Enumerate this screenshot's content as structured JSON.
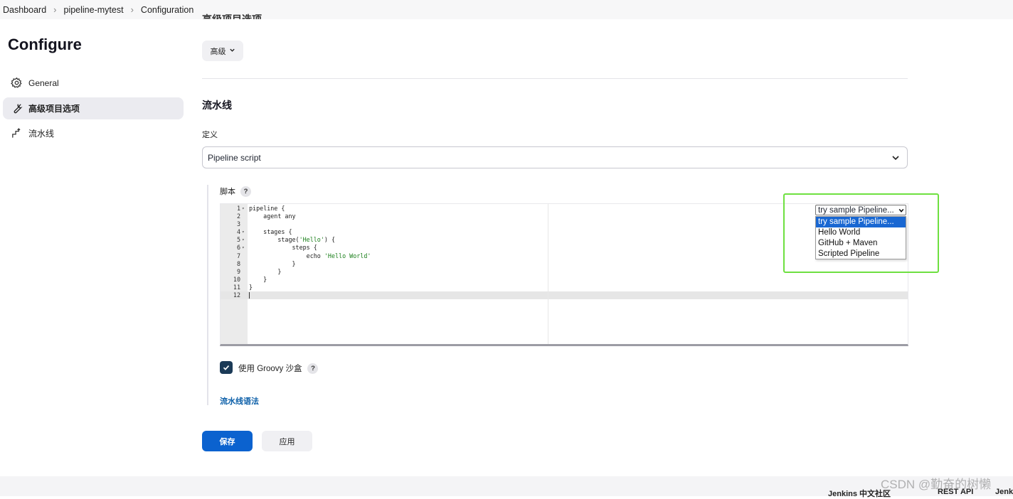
{
  "breadcrumb": [
    "Dashboard",
    "pipeline-mytest",
    "Configuration"
  ],
  "page_title": "Configure",
  "partial_section_header": "高级项目选项",
  "sidebar": {
    "items": [
      {
        "label": "General",
        "icon": "gear-icon",
        "active": false
      },
      {
        "label": "高级项目选项",
        "icon": "wrench-icon",
        "active": true
      },
      {
        "label": "流水线",
        "icon": "pipeline-icon",
        "active": false
      }
    ]
  },
  "advanced": {
    "button_label": "高级"
  },
  "pipeline_section": {
    "title": "流水线",
    "definition_label": "定义",
    "definition_value": "Pipeline script",
    "script_label": "脚本",
    "help": "?"
  },
  "editor": {
    "lines": [
      {
        "n": "1",
        "fold": true,
        "text": "pipeline {"
      },
      {
        "n": "2",
        "fold": false,
        "text": "    agent any"
      },
      {
        "n": "3",
        "fold": false,
        "text": ""
      },
      {
        "n": "4",
        "fold": true,
        "text": "    stages {"
      },
      {
        "n": "5",
        "fold": true,
        "text": "        stage('Hello') {"
      },
      {
        "n": "6",
        "fold": true,
        "text": "            steps {"
      },
      {
        "n": "7",
        "fold": false,
        "text": "                echo 'Hello World'"
      },
      {
        "n": "8",
        "fold": false,
        "text": "            }"
      },
      {
        "n": "9",
        "fold": false,
        "text": "        }"
      },
      {
        "n": "10",
        "fold": false,
        "text": "    }"
      },
      {
        "n": "11",
        "fold": false,
        "text": "}"
      },
      {
        "n": "12",
        "fold": false,
        "text": ""
      }
    ]
  },
  "sample_select": {
    "value": "try sample Pipeline...",
    "options": [
      "try sample Pipeline...",
      "Hello World",
      "GitHub + Maven",
      "Scripted Pipeline"
    ],
    "selected_index": 0
  },
  "sandbox": {
    "label": "使用 Groovy 沙盒",
    "checked": true,
    "help": "?"
  },
  "syntax_link": "流水线语法",
  "buttons": {
    "save": "保存",
    "apply": "应用"
  },
  "footer": {
    "community": "Jenkins 中文社区",
    "rest_api": "REST API",
    "jenkins": "Jenk"
  },
  "watermark": "CSDN @勤奋的树懒",
  "colors": {
    "accent": "#0b62cf",
    "highlight": "#6ee040",
    "checkbox": "#1b3a57",
    "link": "#0a5ea8"
  }
}
